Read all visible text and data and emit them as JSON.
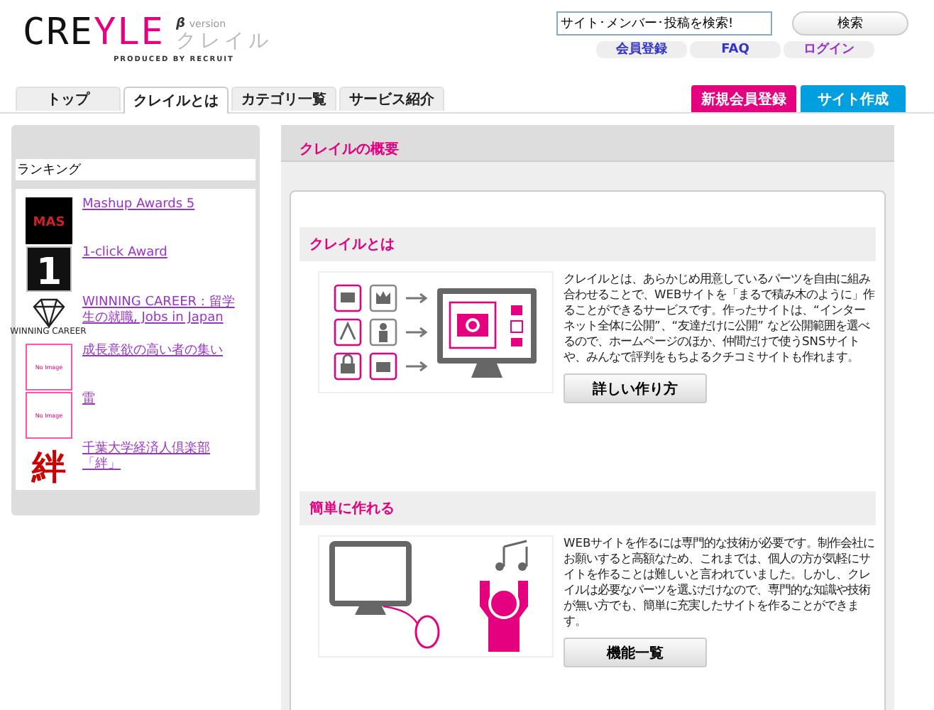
{
  "logo": {
    "text_dark": "CRE",
    "text_accent": "YLE",
    "beta": "β",
    "version": "version",
    "kana": "クレイル",
    "produced": "PRODUCED BY RECRUIT"
  },
  "search": {
    "value": "サイト･メンバー･投稿を検索!",
    "button": "検索"
  },
  "header_links": [
    {
      "label": "会員登録",
      "visited": false
    },
    {
      "label": "FAQ",
      "visited": false
    },
    {
      "label": "ログイン",
      "visited": true
    }
  ],
  "tabs": [
    {
      "label": "トップ",
      "selected": false
    },
    {
      "label": "クレイルとは",
      "selected": true
    },
    {
      "label": "カテゴリ一覧",
      "selected": false
    },
    {
      "label": "サービス紹介",
      "selected": false
    }
  ],
  "action_buttons": [
    {
      "label": "新規会員登録",
      "color": "#e4007f"
    },
    {
      "label": "サイト作成",
      "color": "#00a0e0"
    }
  ],
  "ranking": {
    "title": "ランキング",
    "items": [
      {
        "title": "Mashup Awards 5",
        "thumb": {
          "kind": "mas",
          "text": "MAS"
        }
      },
      {
        "title": "1-click Award",
        "thumb": {
          "kind": "one",
          "text": "1"
        }
      },
      {
        "title": "WINNING CAREER : 留学生の就職, Jobs in Japan",
        "thumb": {
          "kind": "diamond",
          "text": "WINNING CAREER"
        }
      },
      {
        "title": "成長意欲の高い者の集い",
        "thumb": {
          "kind": "noimage",
          "text": "No Image"
        }
      },
      {
        "title": "雷",
        "thumb": {
          "kind": "noimage",
          "text": "No Image"
        }
      },
      {
        "title": "千葉大学経済人倶楽部「絆」",
        "thumb": {
          "kind": "kanji",
          "text": "絆"
        }
      }
    ]
  },
  "overview": {
    "title": "クレイルの概要",
    "sections": [
      {
        "heading": "クレイルとは",
        "kind": "parts",
        "text": "クレイルとは、あらかじめ用意しているパーツを自由に組み合わせることで、WEBサイトを「まるで積み木のように」作ることができるサービスです。作ったサイトは、“インターネット全体に公開”、“友達だけに公開” など公開範囲を選べるので、ホームページのほか、仲間だけで使うSNSサイトや、みんなで評判をもちよるクチコミサイトも作れます。",
        "button": "詳しい作り方"
      },
      {
        "heading": "簡単に作れる",
        "kind": "easy",
        "text": "WEBサイトを作るには専門的な技術が必要です。制作会社にお願いすると高額なため、これまでは、個人の方が気軽にサイトを作ることは難しいと言われていました。しかし、クレイルは必要なパーツを選ぶだけなので、専門的な知識や技術が無い方でも、簡単に充実したサイトを作ることができます。",
        "button": "機能一覧"
      }
    ]
  }
}
